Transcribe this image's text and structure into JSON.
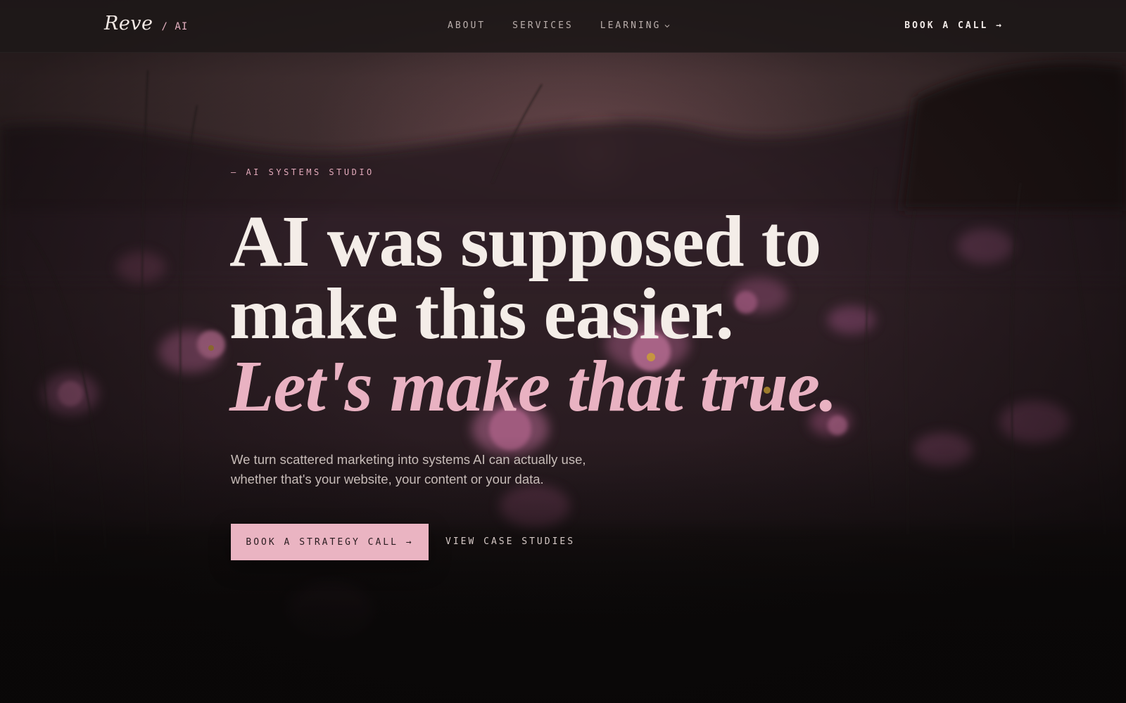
{
  "nav": {
    "logo_word": "Reve",
    "logo_suffix": "/ AI",
    "links": [
      {
        "label": "ABOUT"
      },
      {
        "label": "SERVICES"
      },
      {
        "label": "LEARNING",
        "icon": "chevron-down-icon"
      }
    ],
    "cta_label": "BOOK A CALL →"
  },
  "hero": {
    "eyebrow": "— AI SYSTEMS STUDIO",
    "headline_line1": "AI was supposed to",
    "headline_line2": "make this easier.",
    "headline_accent": "Let's make that true.",
    "subtext_line1": "We turn scattered marketing into systems AI can actually use,",
    "subtext_line2": "whether that's your website, your content or your data.",
    "primary_cta": "BOOK A STRATEGY CALL →",
    "secondary_cta": "VIEW CASE STUDIES",
    "background": "field of pink cosmos flowers at dusk"
  },
  "colors": {
    "accent_pink": "#eab4c2",
    "headline": "#f4ede8",
    "background_dark": "#0b0909",
    "nav_bg": "#1e1818"
  }
}
